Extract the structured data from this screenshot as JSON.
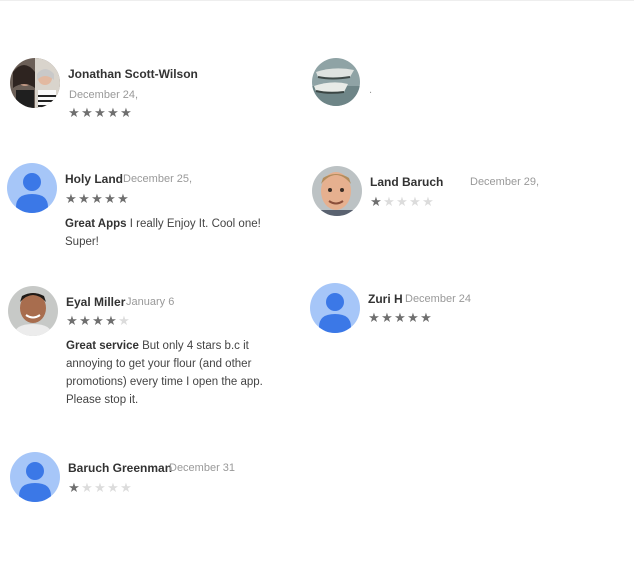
{
  "reviews": [
    {
      "name": "Jonathan Scott-Wilson",
      "date": "December 24,",
      "rating": 5,
      "title": "",
      "text": ""
    },
    {
      "name": "",
      "date": "",
      "rating": null,
      "title": "",
      "text": ""
    },
    {
      "name": "Holy Land",
      "date": "December 25,",
      "rating": 5,
      "title": "Great Apps",
      "text": "I really Enjoy It. Cool one! Super!"
    },
    {
      "name": "Land   Baruch",
      "date": "December 29,",
      "rating": 1,
      "title": "",
      "text": ""
    },
    {
      "name": "Eyal Miller",
      "date": "January 6",
      "rating": 4,
      "title": "Great service",
      "text": "But only 4 stars b.c it annoying to get your flour (and other promotions) every time I open the app. Please stop it."
    },
    {
      "name": "Zuri H",
      "date": "December 24",
      "rating": 5,
      "title": "",
      "text": ""
    },
    {
      "name": "Baruch Greenman",
      "date": "December 31",
      "rating": 1,
      "title": "",
      "text": ""
    }
  ],
  "icons": {
    "generic_avatar": "person-silhouette-icon",
    "star": "star-icon"
  },
  "colors": {
    "generic_avatar_bg": "#a6c6f8",
    "generic_avatar_fg": "#3b78e7",
    "star_on": "#6f6f6f",
    "star_off": "#dcdcdc"
  }
}
